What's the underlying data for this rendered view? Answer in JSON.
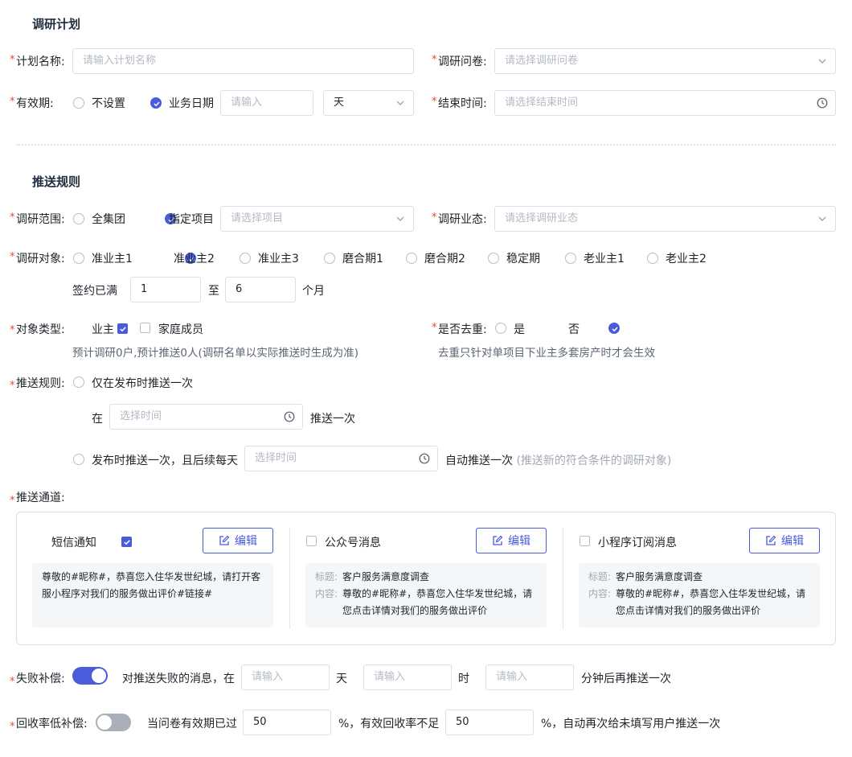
{
  "plan": {
    "section_title": "调研计划",
    "name_label": "计划名称:",
    "name_placeholder": "请输入计划名称",
    "questionnaire_label": "调研问卷:",
    "questionnaire_placeholder": "请选择调研问卷",
    "validity_label": "有效期:",
    "validity_options": [
      "不设置",
      "业务日期"
    ],
    "validity_selected": "业务日期",
    "validity_input_placeholder": "请输入",
    "validity_unit": "天",
    "end_time_label": "结束时间:",
    "end_time_placeholder": "请选择结束时间"
  },
  "push": {
    "section_title": "推送规则",
    "scope_label": "调研范围:",
    "scope_options": [
      "全集团",
      "指定项目"
    ],
    "scope_selected": "指定项目",
    "project_placeholder": "请选择项目",
    "format_label": "调研业态:",
    "format_placeholder": "请选择调研业态",
    "target_label": "调研对象:",
    "target_options": [
      "准业主1",
      "准业主2",
      "准业主3",
      "磨合期1",
      "磨合期2",
      "稳定期",
      "老业主1",
      "老业主2"
    ],
    "target_selected": "准业主2",
    "contract_prefix": "签约已满",
    "contract_from": "1",
    "contract_to_label": "至",
    "contract_to": "6",
    "contract_unit": "个月",
    "object_type_label": "对象类型:",
    "object_type_options": [
      "业主",
      "家庭成员"
    ],
    "object_type_checked": [
      "业主"
    ],
    "object_hint": "预计调研0户,预计推送0人(调研名单以实际推送时生成为准)",
    "dedupe_label": "是否去重:",
    "dedupe_options": [
      "是",
      "否"
    ],
    "dedupe_selected": "否",
    "dedupe_hint": "去重只针对单项目下业主多套房产时才会生效",
    "rule_label": "推送规则:",
    "rule_once": "仅在发布时推送一次",
    "rule_at_prefix": "在",
    "rule_at_placeholder": "选择时间",
    "rule_at_suffix": "推送一次",
    "rule_daily_prefix": "发布时推送一次，且后续每天",
    "rule_daily_placeholder": "选择时间",
    "rule_daily_suffix": "自动推送一次",
    "rule_daily_note": "(推送新的符合条件的调研对象)",
    "rule_selected": "at",
    "channel_label": "推送通道:",
    "channels": [
      {
        "name": "短信通知",
        "checked": true,
        "edit": "编辑",
        "content": "尊敬的#昵称#，恭喜您入住华发世纪城，请打开客服小程序对我们的服务做出评价#链接#"
      },
      {
        "name": "公众号消息",
        "checked": false,
        "edit": "编辑",
        "title_key": "标题:",
        "title": "客户服务满意度调查",
        "content_key": "内容:",
        "content": "尊敬的#昵称#，恭喜您入住华发世纪城，请您点击详情对我们的服务做出评价"
      },
      {
        "name": "小程序订阅消息",
        "checked": false,
        "edit": "编辑",
        "title_key": "标题:",
        "title": "客户服务满意度调查",
        "content_key": "内容:",
        "content": "尊敬的#昵称#，恭喜您入住华发世纪城，请您点击详情对我们的服务做出评价"
      }
    ],
    "fail_label": "失败补偿:",
    "fail_on": true,
    "fail_text": "对推送失败的消息，在",
    "fail_placeholder": "请输入",
    "fail_day": "天",
    "fail_hour": "时",
    "fail_suffix": "分钟后再推送一次",
    "low_label": "回收率低补偿:",
    "low_on": false,
    "low_text": "当问卷有效期已过",
    "low_value1": "50",
    "low_mid": "%，有效回收率不足",
    "low_value2": "50",
    "low_suffix": "%，自动再次给未填写用户推送一次"
  },
  "colors": {
    "accent": "#4a5bdc",
    "required": "#f04438"
  }
}
